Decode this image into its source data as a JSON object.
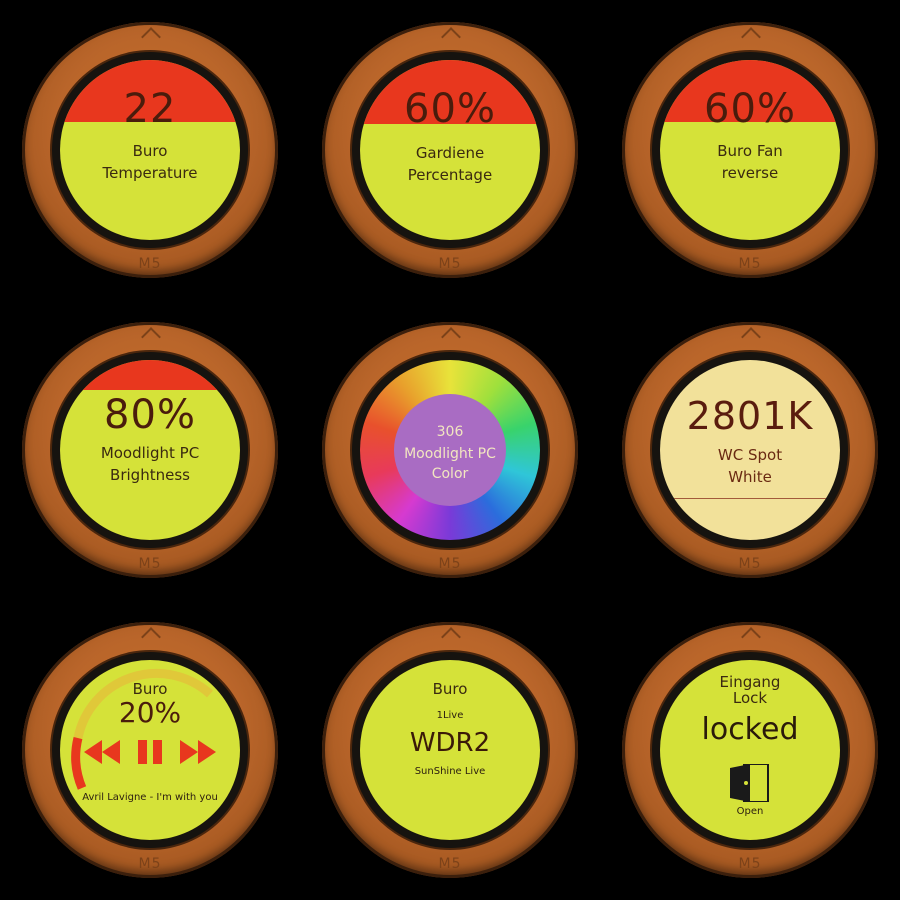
{
  "devices": [
    {
      "value": "22",
      "label1": "Buro",
      "label2": "Temperature",
      "bottom_mark": "M5"
    },
    {
      "value": "60%",
      "label1": "Gardiene",
      "label2": "Percentage",
      "bottom_mark": "M5"
    },
    {
      "value": "60%",
      "label1": "Buro Fan",
      "label2": "reverse",
      "bottom_mark": "M5"
    },
    {
      "value": "80%",
      "label1": "Moodlight PC",
      "label2": "Brightness",
      "bottom_mark": "M5"
    },
    {
      "value": "306",
      "label1": "Moodlight PC",
      "label2": "Color",
      "bottom_mark": "M5"
    },
    {
      "value": "2801K",
      "label1": "WC Spot",
      "label2": "White",
      "bottom_mark": "M5"
    },
    {
      "title": "Buro",
      "value": "20%",
      "track": "Avril Lavigne - I'm with you",
      "bottom_mark": "M5"
    },
    {
      "title": "Buro",
      "station_small": "1Live",
      "value": "WDR2",
      "next_station": "SunShine Live",
      "bottom_mark": "M5"
    },
    {
      "title1": "Eingang",
      "title2": "Lock",
      "value": "locked",
      "action": "Open",
      "bottom_mark": "M5"
    }
  ],
  "colors": {
    "bezel": "#b9652a",
    "screen_lime": "#d5e239",
    "cap_red": "#e8371e",
    "text_dark": "#4a1c0c",
    "color_wheel_center": "#a96cc3",
    "warm_white": "#f2e19a"
  },
  "icons": [
    "chevron-up-icon",
    "rewind-icon",
    "pause-icon",
    "fast-forward-icon",
    "door-open-icon"
  ]
}
